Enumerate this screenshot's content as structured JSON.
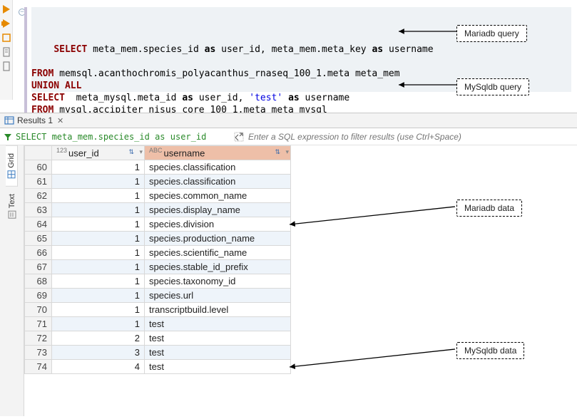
{
  "sql": {
    "l1_select": "SELECT",
    "l1_body": " meta_mem.species_id ",
    "l1_as1": "as",
    "l1_body2": " user_id, meta_mem.meta_key ",
    "l1_as2": "as",
    "l1_body3": " username",
    "l2_from": "FROM",
    "l2_body": " memsql.acanthochromis_polyacanthus_rnaseq_100_1.meta meta_mem",
    "l3_union": "UNION ALL",
    "l4_select": "SELECT",
    "l4_body": "  meta_mysql.meta_id ",
    "l4_as1": "as",
    "l4_body2": " user_id, ",
    "l4_str": "'test'",
    "l4_body3": " ",
    "l4_as2": "as",
    "l4_body4": " username",
    "l5_from": "FROM",
    "l5_body": " mysql.accipiter_nisus_core_100_1.meta meta_mysql"
  },
  "results_tab": {
    "label": "Results 1",
    "close": "✕"
  },
  "filter": {
    "sql_preview": "SELECT meta_mem.species_id as user_id",
    "placeholder": "Enter a SQL expression to filter results (use Ctrl+Space)"
  },
  "columns": {
    "userid": "user_id",
    "username": "username",
    "userid_prefix": "123",
    "username_prefix": "ABC"
  },
  "side": {
    "grid": "Grid",
    "text": "Text"
  },
  "rows": [
    {
      "n": 60,
      "uid": 1,
      "uname": "species.classification"
    },
    {
      "n": 61,
      "uid": 1,
      "uname": "species.classification"
    },
    {
      "n": 62,
      "uid": 1,
      "uname": "species.common_name"
    },
    {
      "n": 63,
      "uid": 1,
      "uname": "species.display_name"
    },
    {
      "n": 64,
      "uid": 1,
      "uname": "species.division"
    },
    {
      "n": 65,
      "uid": 1,
      "uname": "species.production_name"
    },
    {
      "n": 66,
      "uid": 1,
      "uname": "species.scientific_name"
    },
    {
      "n": 67,
      "uid": 1,
      "uname": "species.stable_id_prefix"
    },
    {
      "n": 68,
      "uid": 1,
      "uname": "species.taxonomy_id"
    },
    {
      "n": 69,
      "uid": 1,
      "uname": "species.url"
    },
    {
      "n": 70,
      "uid": 1,
      "uname": "transcriptbuild.level"
    },
    {
      "n": 71,
      "uid": 1,
      "uname": "test"
    },
    {
      "n": 72,
      "uid": 2,
      "uname": "test"
    },
    {
      "n": 73,
      "uid": 3,
      "uname": "test"
    },
    {
      "n": 74,
      "uid": 4,
      "uname": "test"
    }
  ],
  "annot": {
    "mariadb_query": "Mariadb query",
    "mysqldb_query": "MySqldb query",
    "mariadb_data": "Mariadb data",
    "mysqldb_data": "MySqldb data"
  }
}
